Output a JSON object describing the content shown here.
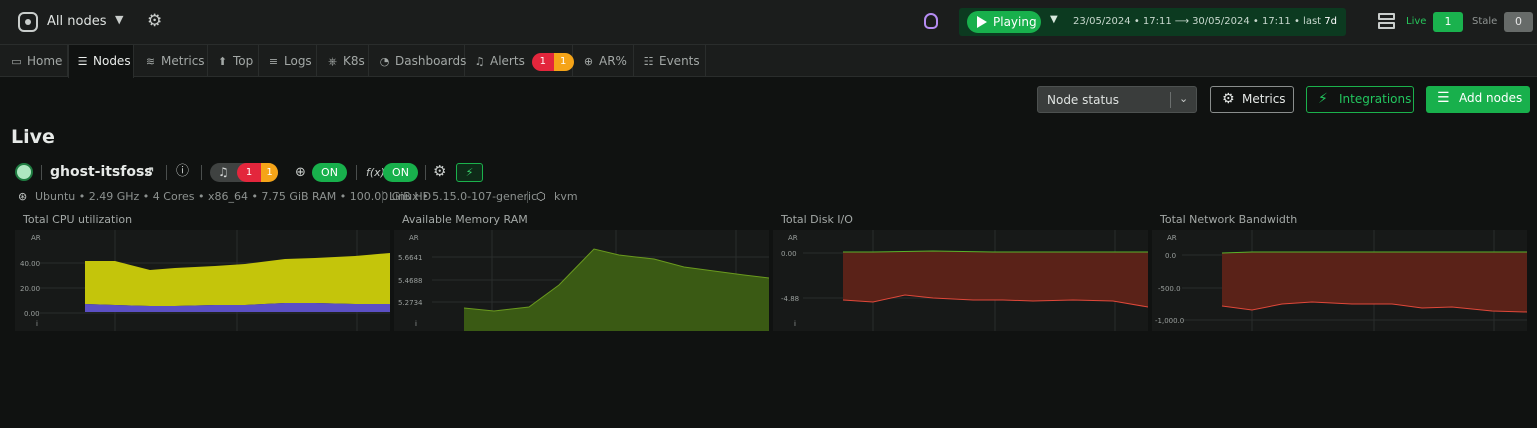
{
  "topbar": {
    "space_selector": "All nodes",
    "playing_label": "Playing",
    "date_from": "23/05/2024 • 17:11",
    "date_to": "30/05/2024 • 17:11",
    "last_label": "• last",
    "last_value": "7d",
    "live_label": "Live",
    "live_count": "1",
    "stale_label": "Stale",
    "stale_count": "0"
  },
  "tabs": [
    {
      "label": "Home",
      "icon": "monitor-icon"
    },
    {
      "label": "Nodes",
      "icon": "nodes-icon"
    },
    {
      "label": "Metrics",
      "icon": "metrics-icon"
    },
    {
      "label": "Top",
      "icon": "arrow-up-icon"
    },
    {
      "label": "Logs",
      "icon": "logs-icon"
    },
    {
      "label": "K8s",
      "icon": "k8s-icon"
    },
    {
      "label": "Dashboards",
      "icon": "dashboard-icon"
    },
    {
      "label": "Alerts",
      "icon": "bell-icon",
      "critical": "1",
      "warning": "1"
    },
    {
      "label": "AR%",
      "icon": "zoom-icon"
    },
    {
      "label": "Events",
      "icon": "events-icon"
    }
  ],
  "toolbar": {
    "node_status": "Node status",
    "metrics_btn": "Metrics",
    "integrations_btn": "Integrations",
    "add_nodes_btn": "Add nodes"
  },
  "section_title": "Live",
  "node": {
    "name": "ghost-itsfoss",
    "alerts_critical": "1",
    "alerts_warning": "1",
    "ar_toggle": "ON",
    "fx_toggle": "ON",
    "os_info": "Ubuntu • 2.49 GHz • 4 Cores • x86_64 • 7.75 GiB RAM • 100.00 GiB HD",
    "kernel_info": "Linux • 5.15.0-107-generic",
    "virt_info": "kvm"
  },
  "colors": {
    "accent_green": "#18b04c",
    "critical": "#e3263c",
    "warning": "#f5a418",
    "cpu_user": "#c4c50b",
    "cpu_system": "#5b4fc4",
    "memory": "#3a5a14",
    "disk": "#5a2218"
  },
  "charts": [
    {
      "title": "Total CPU utilization",
      "ar": "AR",
      "ticks": [
        "40.00",
        "20.00",
        "0.00"
      ],
      "info": "i"
    },
    {
      "title": "Available Memory RAM",
      "ar": "AR",
      "ticks": [
        "5.6641",
        "5.4688",
        "5.2734"
      ],
      "info": "i"
    },
    {
      "title": "Total Disk I/O",
      "ar": "AR",
      "ticks": [
        "0.00",
        "-4.88"
      ],
      "info": "i"
    },
    {
      "title": "Total Network Bandwidth",
      "ar": "AR",
      "ticks": [
        "0.0",
        "-500.0",
        "-1,000.0"
      ]
    }
  ]
}
